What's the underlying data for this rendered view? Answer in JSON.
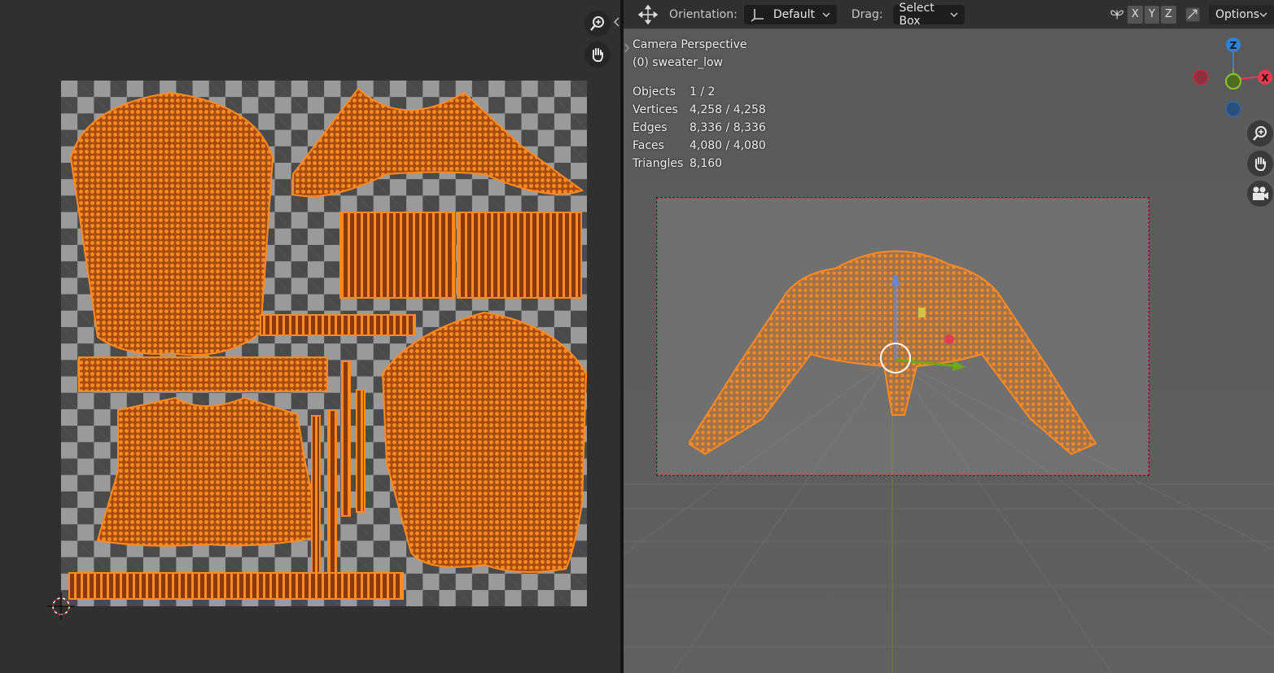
{
  "header": {
    "orientation_label": "Orientation:",
    "orientation_value": "Default",
    "drag_label": "Drag:",
    "drag_value": "Select Box",
    "axis_x": "X",
    "axis_y": "Y",
    "axis_z": "Z",
    "options_label": "Options"
  },
  "overlay": {
    "view_name": "Camera Perspective",
    "object_name": "(0) sweater_low",
    "stats": [
      {
        "label": "Objects",
        "value": "1 / 2"
      },
      {
        "label": "Vertices",
        "value": "4,258 / 4,258"
      },
      {
        "label": "Edges",
        "value": "8,336 / 8,336"
      },
      {
        "label": "Faces",
        "value": "4,080 / 4,080"
      },
      {
        "label": "Triangles",
        "value": "8,160"
      }
    ]
  },
  "gizmo": {
    "x_label": "X",
    "z_label": "Z"
  },
  "colors": {
    "mesh_orange": "#ff8a1f",
    "axis_x": "#e23c50",
    "axis_y": "#6ea81a",
    "axis_z": "#2f82d6"
  }
}
